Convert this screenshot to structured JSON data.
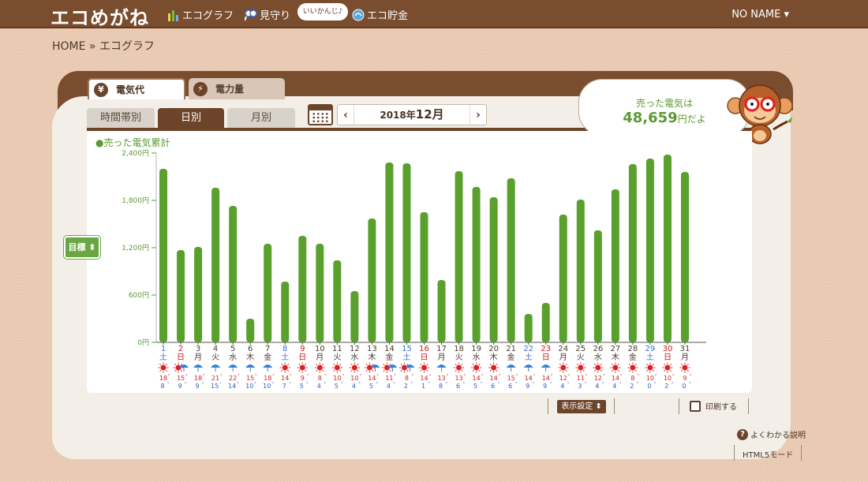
{
  "header": {
    "logo": "エコめがね",
    "nav": [
      {
        "label": "エコグラフ",
        "icon": "bar-chart-icon"
      },
      {
        "label": "見守り",
        "icon": "glasses-icon"
      },
      {
        "label": "エコ貯金",
        "icon": "coin-icon"
      }
    ],
    "bubble": "いいかんじ♪",
    "user": "NO NAME ▾"
  },
  "breadcrumb": "HOME » エコグラフ",
  "top_tabs": [
    {
      "label": "電気代",
      "icon": "¥"
    },
    {
      "label": "電力量",
      "icon": "⚡"
    }
  ],
  "period_tabs": [
    "時間帯別",
    "日別",
    "月別"
  ],
  "date_nav": {
    "prev": "‹",
    "year_label": "2018年",
    "month_label": "12月",
    "next": "›"
  },
  "speech": {
    "line1": "売った電気は",
    "amount": "48,659",
    "suffix": "円だよ"
  },
  "legend": "●売った電気累計",
  "target_button": "目標 ⬍",
  "bottom": {
    "display_settings": "表示設定 ⬍",
    "print": "印刷する",
    "help": "よくわかる説明",
    "html5": "HTML5モード"
  },
  "colors": {
    "bar": "#5aa02c",
    "saturday": "#3d6fd6",
    "sunday": "#cc1a1a",
    "brown": "#6b4429"
  },
  "chart_data": {
    "type": "bar",
    "title": "",
    "ylim": [
      0,
      2400
    ],
    "y_ticks": [
      "0円",
      "600円",
      "1,200円",
      "1,800円",
      "2,400円"
    ],
    "categories": [
      "1",
      "2",
      "3",
      "4",
      "5",
      "6",
      "7",
      "8",
      "9",
      "10",
      "11",
      "12",
      "13",
      "14",
      "15",
      "16",
      "17",
      "18",
      "19",
      "20",
      "21",
      "22",
      "23",
      "24",
      "25",
      "26",
      "27",
      "28",
      "29",
      "30",
      "31"
    ],
    "weekdays": [
      "土",
      "日",
      "月",
      "火",
      "水",
      "木",
      "金",
      "土",
      "日",
      "月",
      "火",
      "水",
      "木",
      "金",
      "土",
      "日",
      "月",
      "火",
      "水",
      "木",
      "金",
      "土",
      "日",
      "月",
      "火",
      "水",
      "木",
      "金",
      "土",
      "日",
      "月"
    ],
    "values": [
      2200,
      1170,
      1210,
      1960,
      1730,
      300,
      1250,
      770,
      1350,
      1250,
      1040,
      650,
      1570,
      2280,
      2270,
      1650,
      790,
      2170,
      1970,
      1840,
      2080,
      360,
      500,
      1620,
      1810,
      1420,
      1940,
      2260,
      2330,
      2380,
      2160
    ],
    "weather": [
      "sun",
      "sun-rain",
      "rain",
      "rain",
      "rain",
      "rain",
      "rain",
      "sun",
      "sun",
      "sun",
      "sun",
      "sun",
      "sun-rain",
      "sun-rain",
      "sun-rain",
      "sun",
      "rain",
      "sun",
      "sun",
      "sun",
      "rain",
      "rain",
      "rain",
      "sun",
      "sun",
      "sun",
      "sun",
      "sun",
      "sun",
      "sun",
      "sun"
    ],
    "temp_high": [
      "18",
      "15",
      "18",
      "21",
      "22",
      "15",
      "18",
      "14",
      "9",
      "8",
      "10",
      "10",
      "14",
      "11",
      "8",
      "14",
      "13",
      "13",
      "14",
      "14",
      "15",
      "14",
      "14",
      "12",
      "11",
      "12",
      "14",
      "8",
      "10",
      "10",
      "9"
    ],
    "temp_low": [
      "8",
      "9",
      "9",
      "15",
      "14",
      "10",
      "10",
      "7",
      "5",
      "4",
      "5",
      "4",
      "5",
      "4",
      "2",
      "1",
      "8",
      "6",
      "5",
      "6",
      "6",
      "9",
      "9",
      "4",
      "3",
      "4",
      "4",
      "2",
      "0",
      "2",
      "0"
    ]
  }
}
